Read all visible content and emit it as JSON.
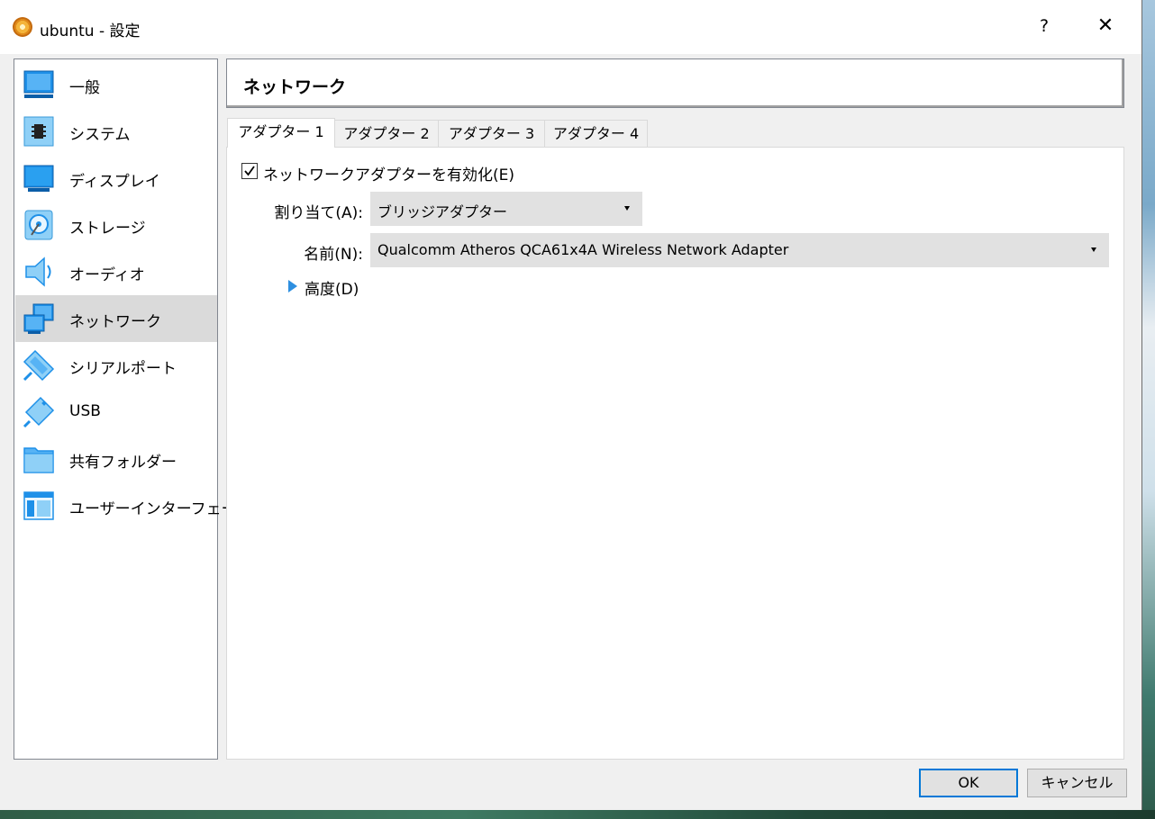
{
  "window": {
    "title": "ubuntu - 設定",
    "help_glyph": "?",
    "close_glyph": "✕"
  },
  "sidebar": {
    "items": [
      {
        "label": "一般",
        "icon": "general-icon"
      },
      {
        "label": "システム",
        "icon": "system-icon"
      },
      {
        "label": "ディスプレイ",
        "icon": "display-icon"
      },
      {
        "label": "ストレージ",
        "icon": "storage-icon"
      },
      {
        "label": "オーディオ",
        "icon": "audio-icon"
      },
      {
        "label": "ネットワーク",
        "icon": "network-icon",
        "selected": true
      },
      {
        "label": "シリアルポート",
        "icon": "serial-port-icon"
      },
      {
        "label": "USB",
        "icon": "usb-icon"
      },
      {
        "label": "共有フォルダー",
        "icon": "shared-folder-icon"
      },
      {
        "label": "ユーザーインターフェース",
        "icon": "user-interface-icon"
      }
    ]
  },
  "panel": {
    "title": "ネットワーク"
  },
  "tabs": [
    {
      "label": "アダプター 1",
      "active": true
    },
    {
      "label": "アダプター 2"
    },
    {
      "label": "アダプター 3"
    },
    {
      "label": "アダプター 4"
    }
  ],
  "adapter": {
    "enable_label": "ネットワークアダプターを有効化(E)",
    "enabled": true,
    "attached_label": "割り当て(A):",
    "attached_value": "ブリッジアダプター",
    "name_label": "名前(N):",
    "name_value": "Qualcomm Atheros QCA61x4A Wireless Network Adapter",
    "advanced_label": "高度(D)"
  },
  "buttons": {
    "ok": "OK",
    "cancel": "キャンセル"
  },
  "colors": {
    "accent": "#0078d7",
    "selected_bg": "#dadada",
    "icon_blue": "#1e90e8"
  }
}
